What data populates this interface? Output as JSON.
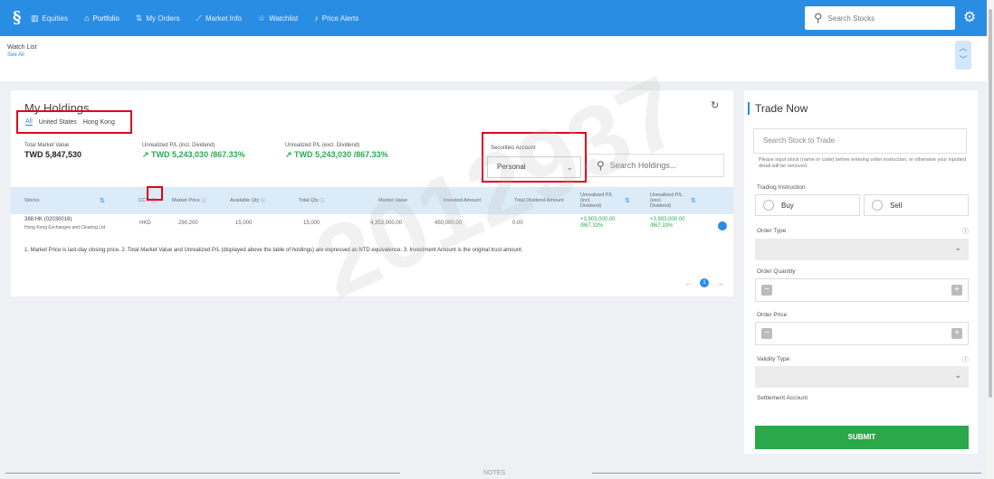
{
  "topbar": {
    "nav": [
      {
        "icon": "bar-chart-icon",
        "glyph": "▥",
        "label": "Equities"
      },
      {
        "icon": "portfolio-icon",
        "glyph": "⌂",
        "label": "Portfolio"
      },
      {
        "icon": "orders-icon",
        "glyph": "⇅",
        "label": "My Orders"
      },
      {
        "icon": "market-info-icon",
        "glyph": "⟋",
        "label": "Market Info"
      },
      {
        "icon": "star-icon",
        "glyph": "☆",
        "label": "Watchlist"
      },
      {
        "icon": "bell-icon",
        "glyph": "♪",
        "label": "Price Alerts"
      }
    ],
    "search_placeholder": "Search Stocks",
    "accent": "#2a8de4"
  },
  "watchlist": {
    "title": "Watch List",
    "see_all": "See All"
  },
  "holdings": {
    "title": "My Holdings",
    "tabs": [
      "All",
      "United States",
      "Hong Kong"
    ],
    "total_market_value_label": "Total Market Value",
    "total_market_value": "TWD 5,847,530",
    "upl_incl_label": "Unrealized P/L (incl. Dividend)",
    "upl_incl_value": "↗ TWD 5,243,030 /867.33%",
    "upl_excl_label": "Unrealized P/L (excl. Dividend)",
    "upl_excl_value": "↗ TWD 5,243,030 /867.33%",
    "account_label": "Securities Account",
    "account_value": "Personal",
    "search_placeholder": "Search Holdings...",
    "columns": {
      "stocks": "Stocks",
      "ccy": "CCY",
      "market_price": "Market Price",
      "available_qty": "Available Qty",
      "total_qty": "Total Qty",
      "market_value": "Market Value",
      "invested_amount": "Invested Amount",
      "total_dividend": "Total Dividend Amount",
      "upl_incl": "Unrealized P/L (incl. Dividend)",
      "upl_excl": "Unrealized P/L (excl. Dividend)"
    },
    "row": {
      "code": "388.HK (02030016)",
      "name": "Hong Kong Exchanges and Clearing Ltd",
      "ccy": "HKD",
      "market_price": "290.200",
      "available_qty": "15,000",
      "total_qty": "15,000",
      "market_value": "4,353,000.00",
      "invested_amount": "450,000.00",
      "total_dividend": "0.00",
      "upl_incl": "+3,903,000.00 /867.33%",
      "upl_excl": "+3,903,000.00 /867.33%"
    },
    "note": "1. Market Price is last-day closing price.  2. Total Market Value and Unrealized P/L (displayed above the table of holdings) are expressed as NTD equivalence.  3. Investment Amount is the original trust amount.",
    "page": "1",
    "watermark": "2012937",
    "positive_color": "#2bab55"
  },
  "trade": {
    "title": "Trade Now",
    "search_placeholder": "Search Stock to Trade",
    "hint": "Please input stock (name or code) before entering order instruction, or otherwise your inputted detail will be removed",
    "instruction_label": "Trading Instruction",
    "buy": "Buy",
    "sell": "Sell",
    "order_type_label": "Order Type",
    "order_qty_label": "Order Quantity",
    "order_price_label": "Order Price",
    "validity_label": "Validity Type",
    "settlement_label": "Settlement Account",
    "submit": "SUBMIT",
    "submit_color": "#2ba84a"
  },
  "footer": {
    "notes": "NOTES"
  }
}
